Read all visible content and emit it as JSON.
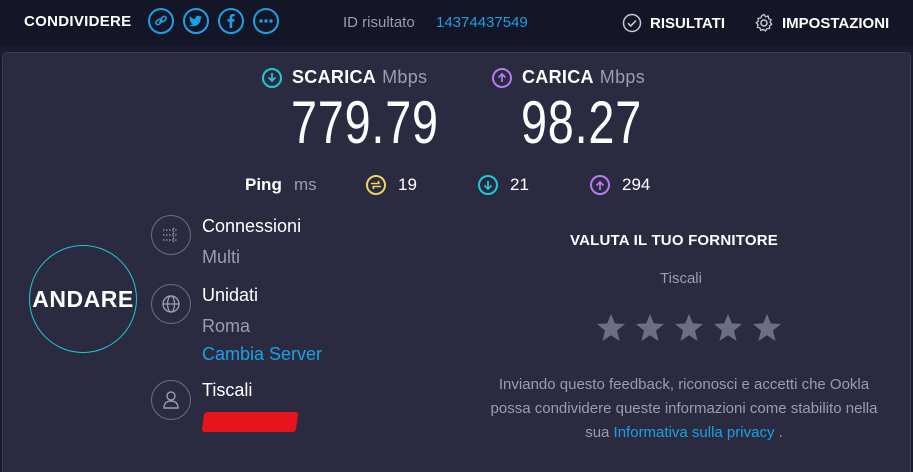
{
  "topbar": {
    "share_label": "CONDIVIDERE",
    "share_icons": [
      "link-icon",
      "twitter-icon",
      "facebook-icon",
      "more-icon"
    ],
    "result_id_label": "ID risultato",
    "result_id_value": "14374437549",
    "results_label": "RISULTATI",
    "settings_label": "IMPOSTAZIONI"
  },
  "download": {
    "label": "SCARICA",
    "unit": "Mbps",
    "value": "779.79",
    "color": "#1ec8d8"
  },
  "upload": {
    "label": "CARICA",
    "unit": "Mbps",
    "value": "98.27",
    "color": "#b77bf0"
  },
  "ping": {
    "label": "Ping",
    "unit": "ms",
    "idle": "19",
    "download": "21",
    "upload": "294",
    "idle_color": "#f0d35a"
  },
  "go_button": "ANDARE",
  "connections": {
    "title": "Connessioni",
    "value": "Multi"
  },
  "server": {
    "title": "Unidati",
    "location": "Roma",
    "change_label": "Cambia Server"
  },
  "provider": {
    "title": "Tiscali"
  },
  "rating": {
    "title": "VALUTA IL TUO FORNITORE",
    "provider": "Tiscali",
    "stars": 5,
    "feedback_text": "Inviando questo feedback, riconosci e accetti che Ookla possa condividere queste informazioni come stabilito nella sua",
    "privacy_link": "Informativa sulla privacy",
    "feedback_end": "."
  },
  "colors": {
    "accent": "#1ca0e3",
    "background": "#1a1b2e",
    "panel": "#2a2b40",
    "redaction": "#e8141c"
  }
}
